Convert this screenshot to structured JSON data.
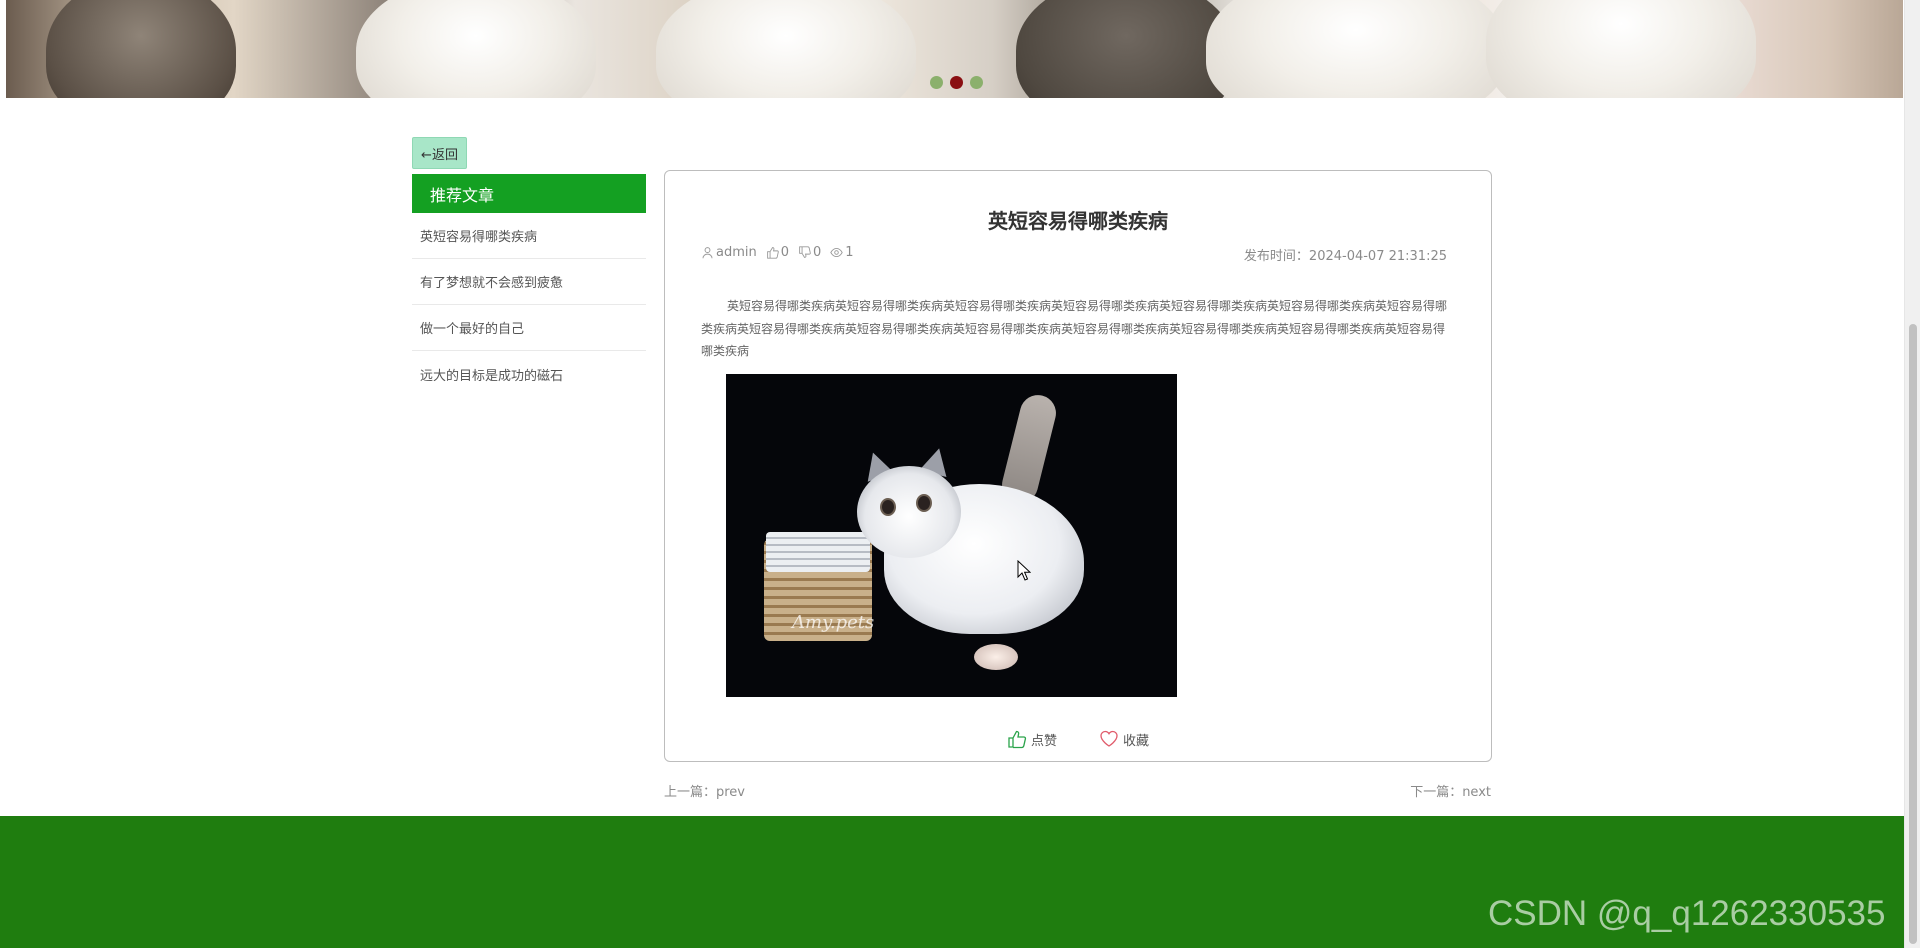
{
  "banner": {
    "carousel_dots": 3,
    "active_dot": 1
  },
  "back_button": {
    "label": "←返回"
  },
  "sidebar": {
    "title": "推荐文章",
    "items": [
      {
        "label": "英短容易得哪类疾病"
      },
      {
        "label": "有了梦想就不会感到疲惫"
      },
      {
        "label": "做一个最好的自己"
      },
      {
        "label": "远大的目标是成功的磁石"
      }
    ]
  },
  "article": {
    "title": "英短容易得哪类疾病",
    "author": "admin",
    "likes": "0",
    "dislikes": "0",
    "views": "1",
    "publish_time": "发布时间：2024-04-07 21:31:25",
    "content": "英短容易得哪类疾病英短容易得哪类疾病英短容易得哪类疾病英短容易得哪类疾病英短容易得哪类疾病英短容易得哪类疾病英短容易得哪类疾病英短容易得哪类疾病英短容易得哪类疾病英短容易得哪类疾病英短容易得哪类疾病英短容易得哪类疾病英短容易得哪类疾病英短容易得哪类疾病",
    "image_watermark": "Amy.pets",
    "like_label": "点赞",
    "favorite_label": "收藏"
  },
  "navigation": {
    "prev": "上一篇：prev",
    "next": "下一篇：next"
  },
  "watermark": "CSDN @q_q1262330535",
  "colors": {
    "accent_green": "#14a022",
    "footer_green": "#1f7d0f",
    "back_button": "#a8e6c8"
  }
}
